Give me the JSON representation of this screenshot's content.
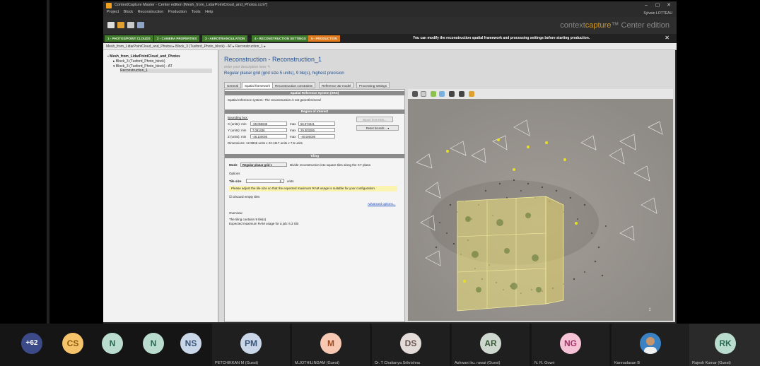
{
  "window": {
    "title": "ContextCapture Master - Center edition [Mesh_from_LidarPointCloud_and_Photos.ccm*]",
    "user": "Sylvain LOTTEAU",
    "brand_prefix": "context",
    "brand_highlight": "capture",
    "brand_suffix": "™ Center edition"
  },
  "menu": [
    "Project",
    "Block",
    "Reconstruction",
    "Production",
    "Tools",
    "Help"
  ],
  "steps": [
    {
      "label": "1 - PHOTOS/POINT CLOUDS",
      "color": "#3f7d2a"
    },
    {
      "label": "2 - CAMERA PROPERTIES",
      "color": "#3f7d2a"
    },
    {
      "label": "3 - AEROTRIANGULATION",
      "color": "#3f7d2a"
    },
    {
      "label": "4 - RECONSTRUCTION SETTINGS",
      "color": "#3f7d2a"
    },
    {
      "label": "5 - PRODUCTION",
      "color": "#e07a1a"
    }
  ],
  "step_hint": "You can modify the reconstruction spatial framework and processing settings before starting production.",
  "breadcrumb": "Mesh_from_LidarPointCloud_and_Photos  ▸  Block_3 (Tusford_Photo_block) - AT  ▸  Reconstruction_1  ▸",
  "tree": {
    "root": "Mesh_from_LidarPointCloud_and_Photos",
    "children": [
      "Block_3 (Tusford_Photo_block)",
      "Block_3 (Tusford_Photo_block) - AT",
      "Reconstruction_1"
    ]
  },
  "reconstruction": {
    "title": "Reconstruction - Reconstruction_1",
    "description_placeholder": "enter your description here",
    "summary": "Regular planar grid (grid size 5 units), 9 tile(s), highest precision"
  },
  "tabs": [
    "General",
    "Spatial framework",
    "Reconstruction constraints",
    "Reference 3D model",
    "Processing settings"
  ],
  "srs": {
    "header": "Spatial Reference System (SRS)",
    "label": "Spatial reference system:",
    "value": "The reconstruction is not georeferenced."
  },
  "roi": {
    "header": "Region of interest",
    "bbox_label": "Bounding box:",
    "x_label": "X (units): min",
    "x_min": "-69.058845",
    "x_max": "56.074341",
    "y_label": "Y (units): min",
    "y_min": "7.091436",
    "y_max": "29.303206",
    "z_label": "Z (units): min",
    "z_min": "-48.100000",
    "z_max": "-40.500000",
    "max_label": "max",
    "import_button": "Import from KML...",
    "reset_button": "Reset bounds...",
    "dimensions": "Dimensions: 12.9846 units x 22.1117 units x 7.6 units"
  },
  "tiling": {
    "header": "Tiling",
    "mode_label": "Mode",
    "mode_value": "Regular planar grid",
    "mode_desc": "Divide reconstruction into square tiles along the XY plane.",
    "options_label": "Options",
    "tile_size_label": "Tile size",
    "tile_size_value": "5",
    "tile_size_unit": "units",
    "warning": "Please adjust the tile size so that the expected maximum RAM usage is suitable for your configuration.",
    "discard_label": "Discard empty tiles",
    "advanced_link": "Advanced options...",
    "overview_label": "Overview",
    "overview_line1": "The tiling contains 9 tile(s)",
    "overview_line2": "Expected maximum RAM usage for a job: 6.3 GB"
  },
  "participants": [
    {
      "initials": "+62",
      "name": "",
      "color": "#3d4a8a",
      "text_color": "#ffffff"
    },
    {
      "initials": "CS",
      "name": "",
      "color": "#f5c46a",
      "text_color": "#8a5a10"
    },
    {
      "initials": "N",
      "name": "",
      "color": "#b9dccf",
      "text_color": "#2a6a52"
    },
    {
      "initials": "N",
      "name": "",
      "color": "#b9dccf",
      "text_color": "#2a6a52"
    },
    {
      "initials": "NS",
      "name": "",
      "color": "#c9d7e8",
      "text_color": "#3a5578"
    },
    {
      "initials": "PM",
      "name": "PETCHIKKAN M (Guest)",
      "color": "#c9d7e8",
      "text_color": "#3a5578"
    },
    {
      "initials": "M",
      "name": "M.JOTHILINGAM (Guest)",
      "color": "#f7c9b2",
      "text_color": "#a04a22"
    },
    {
      "initials": "DS",
      "name": "Dr. T Chaitanya Srikrishna",
      "color": "#e3dcd9",
      "text_color": "#6a5550"
    },
    {
      "initials": "AR",
      "name": "Ashwani ku. rawat (Guest)",
      "color": "#cfd8cf",
      "text_color": "#3a5a3a"
    },
    {
      "initials": "NG",
      "name": "N. R. Gowri",
      "color": "#f6c3d6",
      "text_color": "#a0336a"
    },
    {
      "initials": "",
      "name": "Kannadasan B",
      "color": "#3b82c4",
      "text_color": "#ffffff"
    },
    {
      "initials": "RK",
      "name": "Rajesh Kumar (Guest)",
      "color": "#b9dccf",
      "text_color": "#2a6a52"
    }
  ]
}
